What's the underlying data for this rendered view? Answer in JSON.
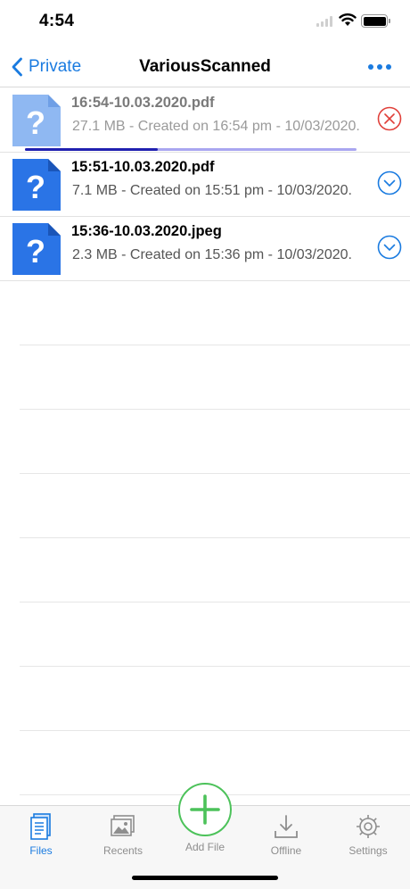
{
  "status_bar": {
    "time": "4:54"
  },
  "nav": {
    "back_label": "Private",
    "title": "VariousScanned"
  },
  "files": [
    {
      "name": "16:54-10.03.2020.pdf",
      "meta": "27.1 MB - Created on 16:54 pm - 10/03/2020.",
      "state": "uploading",
      "progress": 0.4,
      "action_icon": "cancel-icon"
    },
    {
      "name": "15:51-10.03.2020.pdf",
      "meta": "7.1 MB - Created on 15:51 pm - 10/03/2020.",
      "state": "done",
      "action_icon": "chevron-down-circle-icon"
    },
    {
      "name": "15:36-10.03.2020.jpeg",
      "meta": "2.3 MB - Created on 15:36 pm - 10/03/2020.",
      "state": "done",
      "action_icon": "chevron-down-circle-icon"
    }
  ],
  "tabs": {
    "files": "Files",
    "recents": "Recents",
    "add_file": "Add File",
    "offline": "Offline",
    "settings": "Settings"
  },
  "colors": {
    "accent": "#1a7be0",
    "add": "#4cc25a",
    "cancel": "#e0403a",
    "file_icon": "#2a74e6",
    "file_icon_faded": "#8fb8f2"
  }
}
